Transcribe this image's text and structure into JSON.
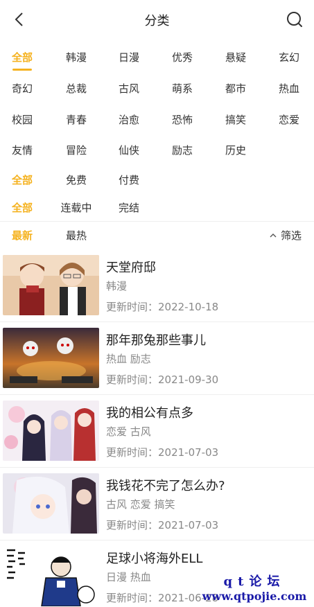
{
  "header": {
    "title": "分类",
    "back_icon": "chevron-left-icon",
    "search_icon": "search-icon"
  },
  "filters": {
    "genres": [
      [
        "全部",
        "韩漫",
        "日漫",
        "优秀",
        "悬疑",
        "玄幻"
      ],
      [
        "奇幻",
        "总裁",
        "古风",
        "萌系",
        "都市",
        "热血"
      ],
      [
        "校园",
        "青春",
        "治愈",
        "恐怖",
        "搞笑",
        "恋爱"
      ],
      [
        "友情",
        "冒险",
        "仙侠",
        "励志",
        "历史"
      ]
    ],
    "price": [
      "全部",
      "免费",
      "付费"
    ],
    "status": [
      "全部",
      "连载中",
      "完结"
    ],
    "active_color": "#f5b21f"
  },
  "sort": {
    "latest": "最新",
    "hottest": "最热",
    "filter_label": "筛选"
  },
  "comics": [
    {
      "title": "天堂府邸",
      "tags": "韩漫",
      "updated": "更新时间：2022-10-18"
    },
    {
      "title": "那年那兔那些事儿",
      "tags": "热血  励志",
      "updated": "更新时间：2021-09-30"
    },
    {
      "title": "我的相公有点多",
      "tags": "恋爱  古风",
      "updated": "更新时间：2021-07-03"
    },
    {
      "title": "我钱花不完了怎么办?",
      "tags": "古风  恋爱  搞笑",
      "updated": "更新时间：2021-07-03"
    },
    {
      "title": "足球小将海外ELL",
      "tags": "日漫  热血",
      "updated": "更新时间：2021-06-28"
    }
  ],
  "watermark": {
    "line1": "qt论坛",
    "line2": "www.qtpojie.com"
  }
}
